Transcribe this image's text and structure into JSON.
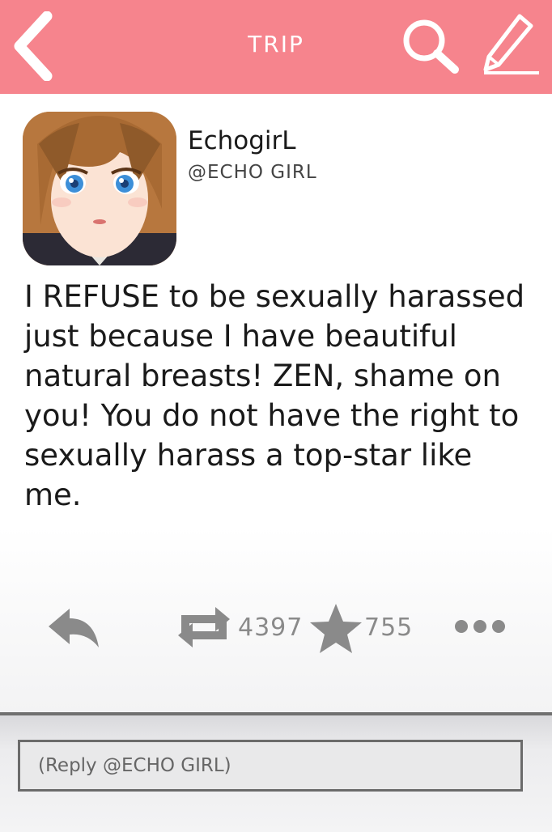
{
  "header": {
    "title": "TRIP",
    "back_icon": "chevron-left-icon",
    "search_icon": "search-icon",
    "compose_icon": "pencil-icon",
    "background_color": "#f6848d"
  },
  "post": {
    "display_name": "EchogirL",
    "handle": "@ECHO GIRL",
    "body": "I REFUSE to be sexually harassed just because I have beautiful natural breasts! ZEN, shame on you! You do not have the right to sexually harass a top-star like me.",
    "actions": {
      "reply_icon": "reply-icon",
      "retweet_icon": "retweet-icon",
      "retweet_count": "4397",
      "favorite_icon": "star-icon",
      "favorite_count": "755",
      "more_icon": "more-dots-icon"
    }
  },
  "footer": {
    "reply_placeholder": "(Reply @ECHO GIRL)"
  }
}
